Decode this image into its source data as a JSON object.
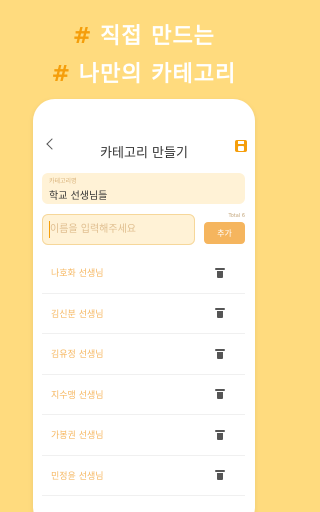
{
  "headline": {
    "line1_hash": "#",
    "line1_text": "직접 만드는",
    "line2_hash": "#",
    "line2_text": "나만의 카테고리"
  },
  "header": {
    "title": "카테고리 만들기",
    "back_icon": "chevron-left-icon",
    "save_icon": "save-icon"
  },
  "category_field": {
    "label": "카테고리명",
    "value": "학교 선생님들"
  },
  "name_input": {
    "placeholder": "이름을 입력해주세요",
    "value": ""
  },
  "total_label": "Total 6",
  "add_button": "추가",
  "items": [
    {
      "name": "나호화 선생님"
    },
    {
      "name": "김신분 선생님"
    },
    {
      "name": "김유정 선생님"
    },
    {
      "name": "지수맹 선생님"
    },
    {
      "name": "가봉권 선생님"
    },
    {
      "name": "민정윤 선생님"
    }
  ],
  "colors": {
    "background": "#FFDB7E",
    "accent": "#F59E0B",
    "button": "#F5B55E",
    "item_text": "#F6B965"
  }
}
